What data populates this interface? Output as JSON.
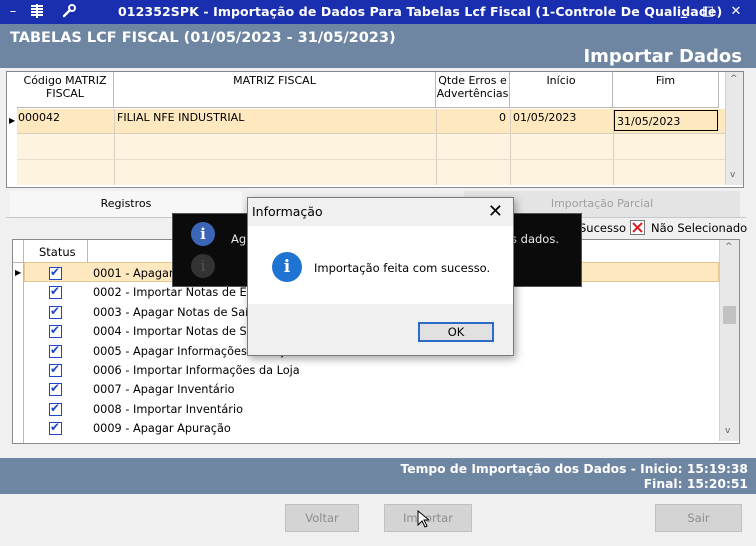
{
  "window": {
    "title": "012352SPK - Importação de Dados Para Tabelas Lcf Fiscal (1-Controle De Qualidade)",
    "minimize": "_",
    "maximize": "□",
    "close": "✕"
  },
  "header": {
    "title": "TABELAS LCF FISCAL (01/05/2023 - 31/05/2023)",
    "action": "Importar Dados"
  },
  "top_grid": {
    "columns": [
      "Código MATRIZ FISCAL",
      "MATRIZ FISCAL",
      "Qtde Erros e Advertências",
      "Início",
      "Fim"
    ],
    "row": {
      "codigo": "000042",
      "matriz": "FILIAL NFE INDUSTRIAL",
      "erros": "0",
      "inicio": "01/05/2023",
      "fim": "31/05/2023"
    }
  },
  "tabs": {
    "registros": "Registros",
    "importacao_parcial": "Importação Parcial"
  },
  "legend": {
    "sucesso": "Sucesso",
    "nao_selecionado": "Não Selecionado"
  },
  "low_grid": {
    "status_header": "Status",
    "rows": [
      "0001 - Apagar I",
      "0002 - Importar Notas de Entr",
      "0003 - Apagar Notas de Saída",
      "0004 - Importar Notas de Saíd",
      "0005 - Apagar Informações da Loja",
      "0006 - Importar Informações da Loja",
      "0007 - Apagar Inventário",
      "0008 - Importar Inventário",
      "0009 - Apagar Apuração"
    ]
  },
  "toast": {
    "text_left": "Ag",
    "text_right": "s dados."
  },
  "dialog": {
    "title": "Informação",
    "close": "✕",
    "message": "Importação feita com sucesso.",
    "ok": "OK"
  },
  "status": {
    "line1": "Tempo de Importação dos Dados - Inicio: 15:19:38",
    "line2": "Final: 15:20:51"
  },
  "buttons": {
    "voltar": "Voltar",
    "importar": "Importar",
    "sair": "Sair"
  }
}
